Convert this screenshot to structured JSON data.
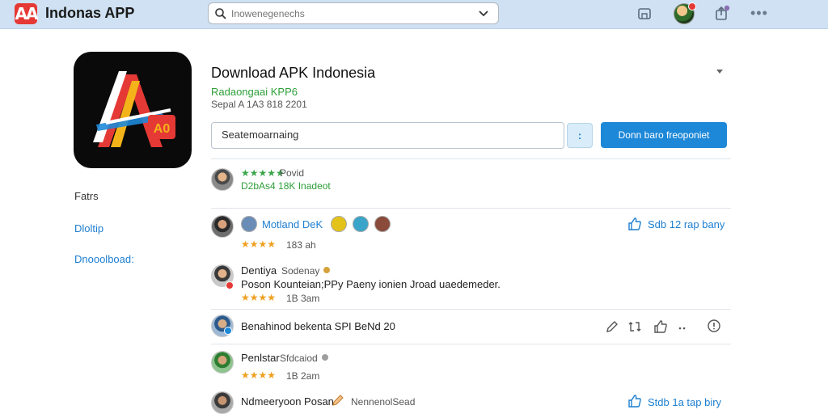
{
  "topbar": {
    "app_name": "Indonas APP",
    "logo_text": "AA",
    "search_placeholder": "Inowenegenechs"
  },
  "app": {
    "title": "Download APK Indonesia",
    "developer": "Radaongaai KPP6",
    "meta": "Sepal A 1A3 818 2201",
    "icon_text": "A",
    "icon_badge": "A0"
  },
  "form": {
    "field_value": "Seatemoarnaing",
    "small_button": ":",
    "download_button": "Donn baro freoponiet"
  },
  "rating_summary": {
    "stars": "★★★★★",
    "label": "Povid",
    "stats": "D2bAs4  18K Inadeot"
  },
  "sidebar": {
    "items": [
      {
        "label": "Fatrs"
      },
      {
        "label": "Dloltip"
      },
      {
        "label": "Dnooolboad:"
      }
    ]
  },
  "reviews": [
    {
      "name": "Motland DeK",
      "stars": "★★★★",
      "time": "183 ah",
      "action": "Sdb 12 rap bany"
    },
    {
      "name": "Dentiya",
      "sub": "Sodenay",
      "body": "Poson Kounteian;PPy Paeny ionien Jroad uaedemeder.",
      "stars": "★★★★",
      "time": "1B 3am"
    },
    {
      "name": "Benahinod bekenta SPI BeNd 20"
    },
    {
      "name": "Penlstar",
      "sub": "Sfdcaiod",
      "stars": "★★★★",
      "time": "1B 2am"
    },
    {
      "name": "Ndmeeryoon Posan",
      "sub": "NennenolSead",
      "action": "Stdb 1a tap biry"
    }
  ],
  "colors": {
    "topbar": "#cfe1f3",
    "accent": "#1e88d8",
    "green": "#2e9e3a",
    "star": "#f0a020"
  }
}
